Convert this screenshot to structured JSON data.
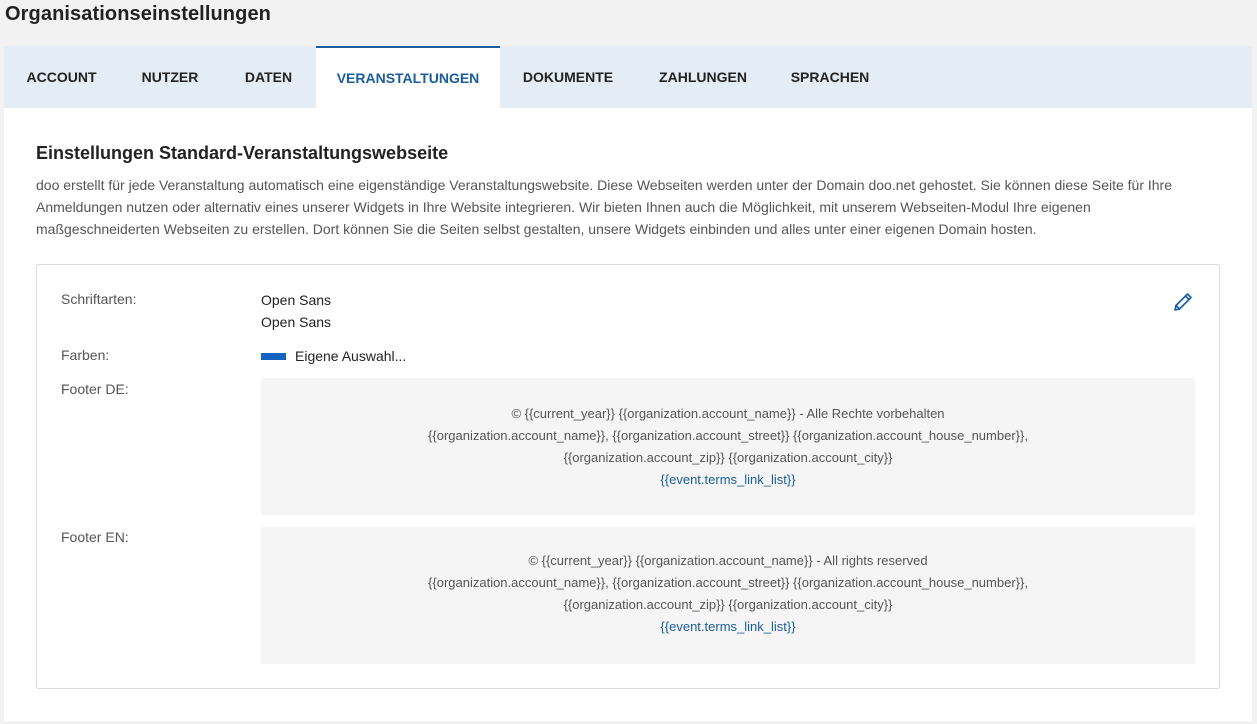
{
  "page_title": "Organisationseinstellungen",
  "tabs": [
    {
      "label": "ACCOUNT"
    },
    {
      "label": "NUTZER"
    },
    {
      "label": "DATEN"
    },
    {
      "label": "VERANSTALTUNGEN",
      "active": true
    },
    {
      "label": "DOKUMENTE"
    },
    {
      "label": "ZAHLUNGEN"
    },
    {
      "label": "SPRACHEN"
    }
  ],
  "section": {
    "title": "Einstellungen Standard-Veranstaltungswebseite",
    "description": "doo erstellt für jede Veranstaltung automatisch eine eigenständige Veranstaltungswebsite. Diese Webseiten werden unter der Domain doo.net gehostet. Sie können diese Seite für Ihre Anmeldungen nutzen oder alternativ eines unserer Widgets in Ihre Website integrieren. Wir bieten Ihnen auch die Möglichkeit, mit unserem Webseiten-Modul Ihre eigenen maßgeschneiderten Webseiten zu erstellen. Dort können Sie die Seiten selbst gestalten, unsere Widgets einbinden und alles unter einer eigenen Domain hosten."
  },
  "settings": {
    "fonts_label": "Schriftarten:",
    "font_1": "Open Sans",
    "font_2": "Open Sans",
    "colors_label": "Farben:",
    "colors_value": "Eigene Auswahl...",
    "color_swatch": "#1565c0",
    "footer_de_label": "Footer DE:",
    "footer_de": {
      "line1": "© {{current_year}} {{organization.account_name}} - Alle Rechte vorbehalten",
      "line2": "{{organization.account_name}}, {{organization.account_street}} {{organization.account_house_number}},",
      "line3": "{{organization.account_zip}} {{organization.account_city}}",
      "link": "{{event.terms_link_list}}"
    },
    "footer_en_label": "Footer EN:",
    "footer_en": {
      "line1": "© {{current_year}} {{organization.account_name}} - All rights reserved",
      "line2": "{{organization.account_name}}, {{organization.account_street}} {{organization.account_house_number}},",
      "line3": "{{organization.account_zip}} {{organization.account_city}}",
      "link": "{{event.terms_link_list}}"
    },
    "edit_icon": "pencil-icon"
  },
  "colors": {
    "accent": "#1a5d9e",
    "tab_bar_bg": "#e4ecf6"
  }
}
